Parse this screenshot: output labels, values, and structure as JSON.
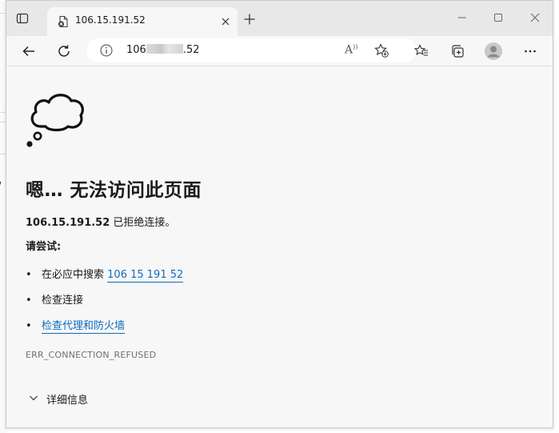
{
  "browser": {
    "tab_title": "106.15.191.52",
    "address_prefix": "106",
    "address_suffix": ".52",
    "read_aloud_label": "A͓"
  },
  "error_page": {
    "title": "嗯… 无法访问此页面",
    "host": "106.15.191.52",
    "message": "已拒绝连接。",
    "try_label": "请尝试:",
    "suggestions": [
      {
        "bullet": "•",
        "prefix": "在必应中搜索",
        "link": "106 15 191 52"
      },
      {
        "bullet": "•",
        "text": "检查连接"
      },
      {
        "bullet": "•",
        "link": "检查代理和防火墙"
      }
    ],
    "error_code": "ERR_CONNECTION_REFUSED",
    "details_label": "详细信息"
  },
  "colors": {
    "link": "#0f6cbd",
    "tabbar": "#e8e8e8",
    "page_bg": "#f7f7f7"
  },
  "icons": [
    "tab-actions-icon",
    "favicon-error-icon",
    "tab-close-icon",
    "new-tab-icon",
    "minimize-icon",
    "maximize-icon",
    "close-icon",
    "back-arrow-icon",
    "refresh-icon",
    "info-icon",
    "read-aloud-icon",
    "add-favorite-icon",
    "favorites-icon",
    "collections-icon",
    "profile-avatar-icon",
    "more-icon",
    "thought-cloud-icon",
    "chevron-down-icon"
  ]
}
